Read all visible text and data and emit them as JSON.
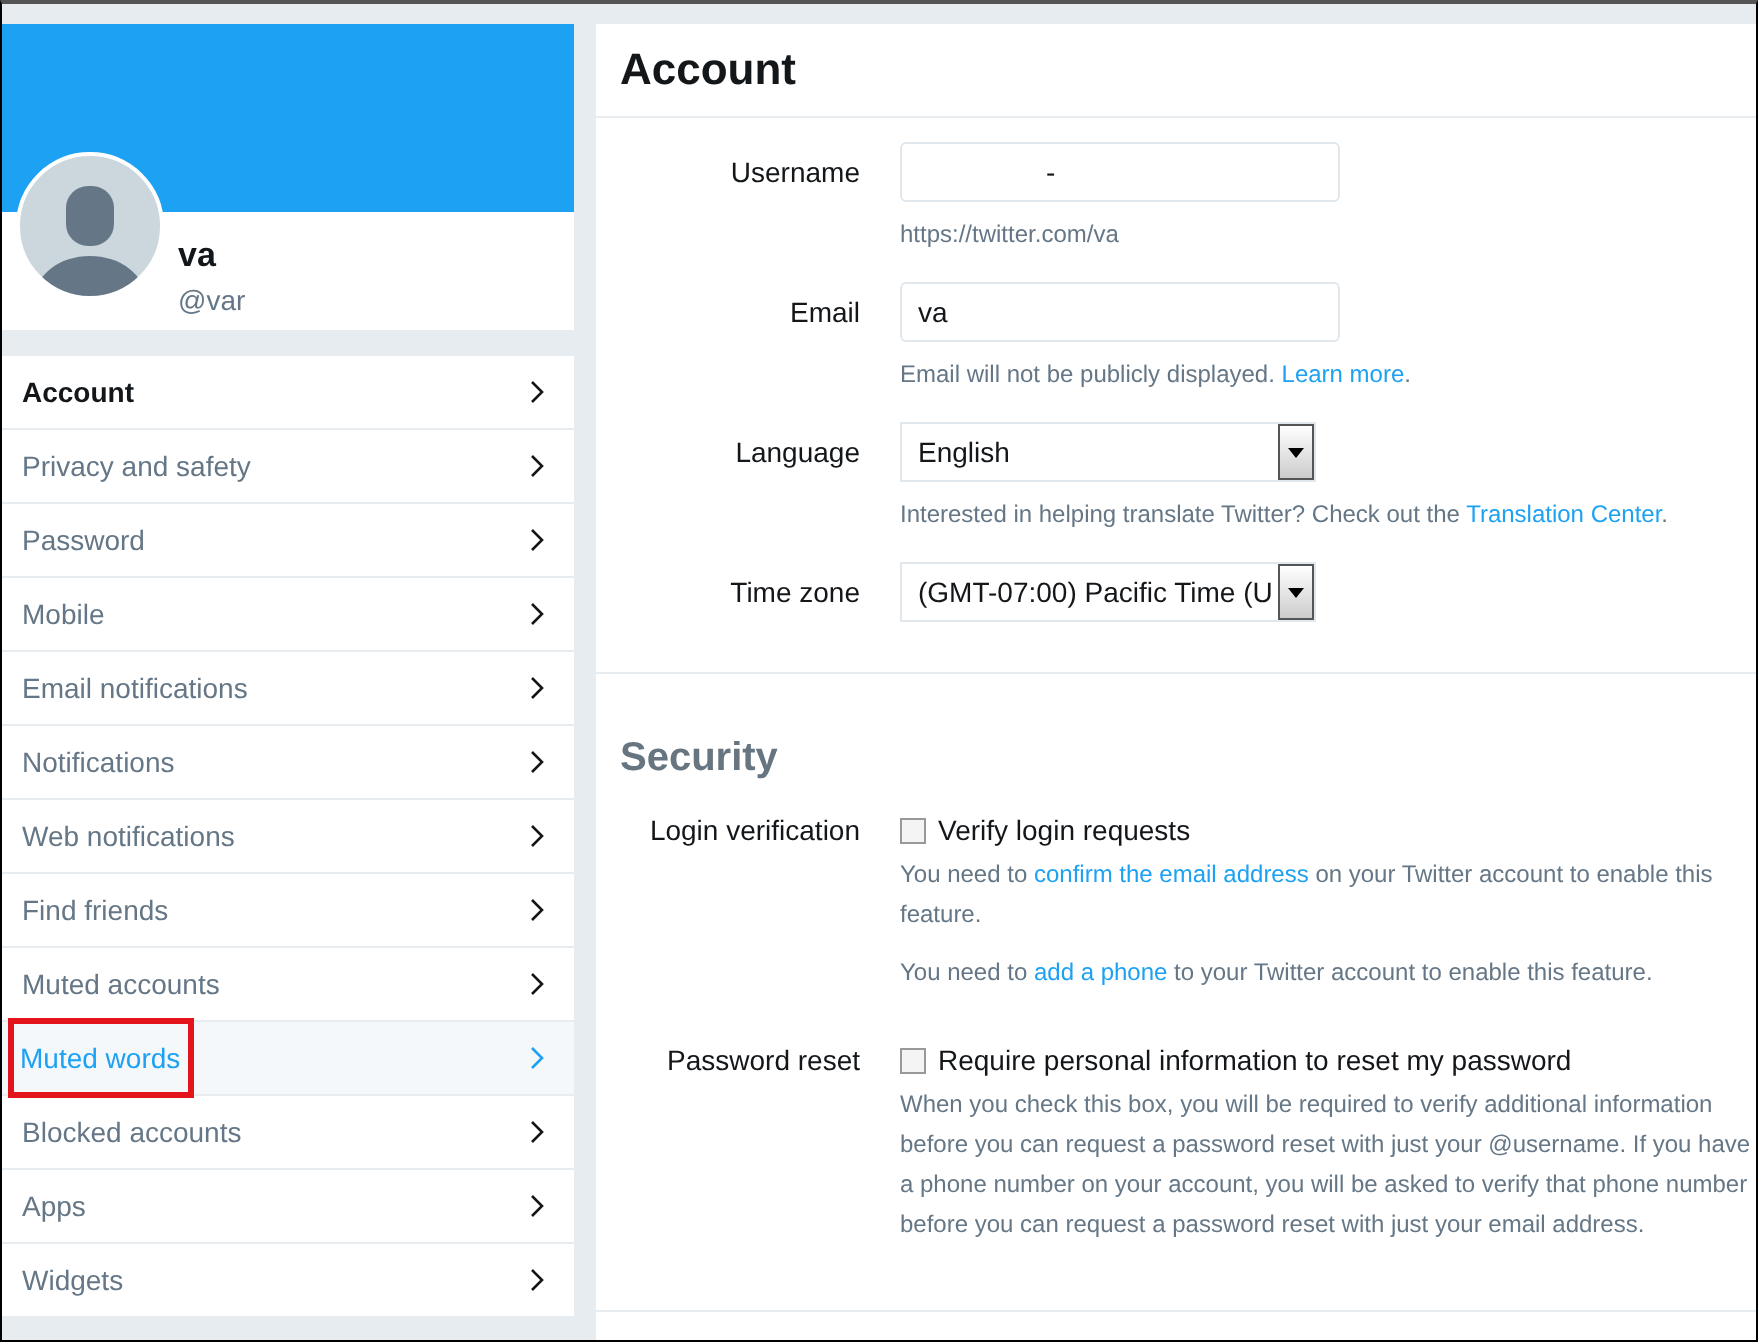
{
  "profile": {
    "name": "va",
    "handle": "@var"
  },
  "sidebar": {
    "items": [
      {
        "label": "Account",
        "selected": true,
        "hovered": false,
        "annotated": false
      },
      {
        "label": "Privacy and safety",
        "selected": false,
        "hovered": false,
        "annotated": false
      },
      {
        "label": "Password",
        "selected": false,
        "hovered": false,
        "annotated": false
      },
      {
        "label": "Mobile",
        "selected": false,
        "hovered": false,
        "annotated": false
      },
      {
        "label": "Email notifications",
        "selected": false,
        "hovered": false,
        "annotated": false
      },
      {
        "label": "Notifications",
        "selected": false,
        "hovered": false,
        "annotated": false
      },
      {
        "label": "Web notifications",
        "selected": false,
        "hovered": false,
        "annotated": false
      },
      {
        "label": "Find friends",
        "selected": false,
        "hovered": false,
        "annotated": false
      },
      {
        "label": "Muted accounts",
        "selected": false,
        "hovered": false,
        "annotated": false
      },
      {
        "label": "Muted words",
        "selected": false,
        "hovered": true,
        "annotated": true
      },
      {
        "label": "Blocked accounts",
        "selected": false,
        "hovered": false,
        "annotated": false
      },
      {
        "label": "Apps",
        "selected": false,
        "hovered": false,
        "annotated": false
      },
      {
        "label": "Widgets",
        "selected": false,
        "hovered": false,
        "annotated": false
      }
    ]
  },
  "account": {
    "title": "Account",
    "fields": [
      {
        "kind": "text",
        "label": "Username",
        "value": "-",
        "help": [
          {
            "text": "https://twitter.com/va"
          }
        ]
      },
      {
        "kind": "text",
        "label": "Email",
        "value": "va",
        "help": [
          {
            "text": "Email will not be publicly displayed. "
          },
          {
            "link": "Learn more"
          },
          {
            "text": "."
          }
        ]
      },
      {
        "kind": "select",
        "label": "Language",
        "value": "English",
        "help": [
          {
            "text": "Interested in helping translate Twitter? Check out the "
          },
          {
            "link": "Translation Center"
          },
          {
            "text": "."
          }
        ]
      },
      {
        "kind": "select",
        "label": "Time zone",
        "value": "(GMT-07:00) Pacific Time (U"
      }
    ]
  },
  "security": {
    "title": "Security",
    "options": [
      {
        "label": "Login verification",
        "checkbox": "Verify login requests",
        "checked": false,
        "help": [
          [
            {
              "text": "You need to "
            },
            {
              "link": "confirm the email address"
            },
            {
              "text": " on your Twitter account to enable this feature."
            }
          ],
          [
            {
              "text": "You need to "
            },
            {
              "link": "add a phone"
            },
            {
              "text": " to your Twitter account to enable this feature."
            }
          ]
        ]
      },
      {
        "label": "Password reset",
        "checkbox": "Require personal information to reset my password",
        "checked": false,
        "help": [
          [
            {
              "text": "When you check this box, you will be required to verify additional information before you can request a password reset with just your @username. If you have a phone number on your account, you will be asked to verify that phone number before you can request a password reset with just your email address."
            }
          ]
        ]
      }
    ]
  }
}
